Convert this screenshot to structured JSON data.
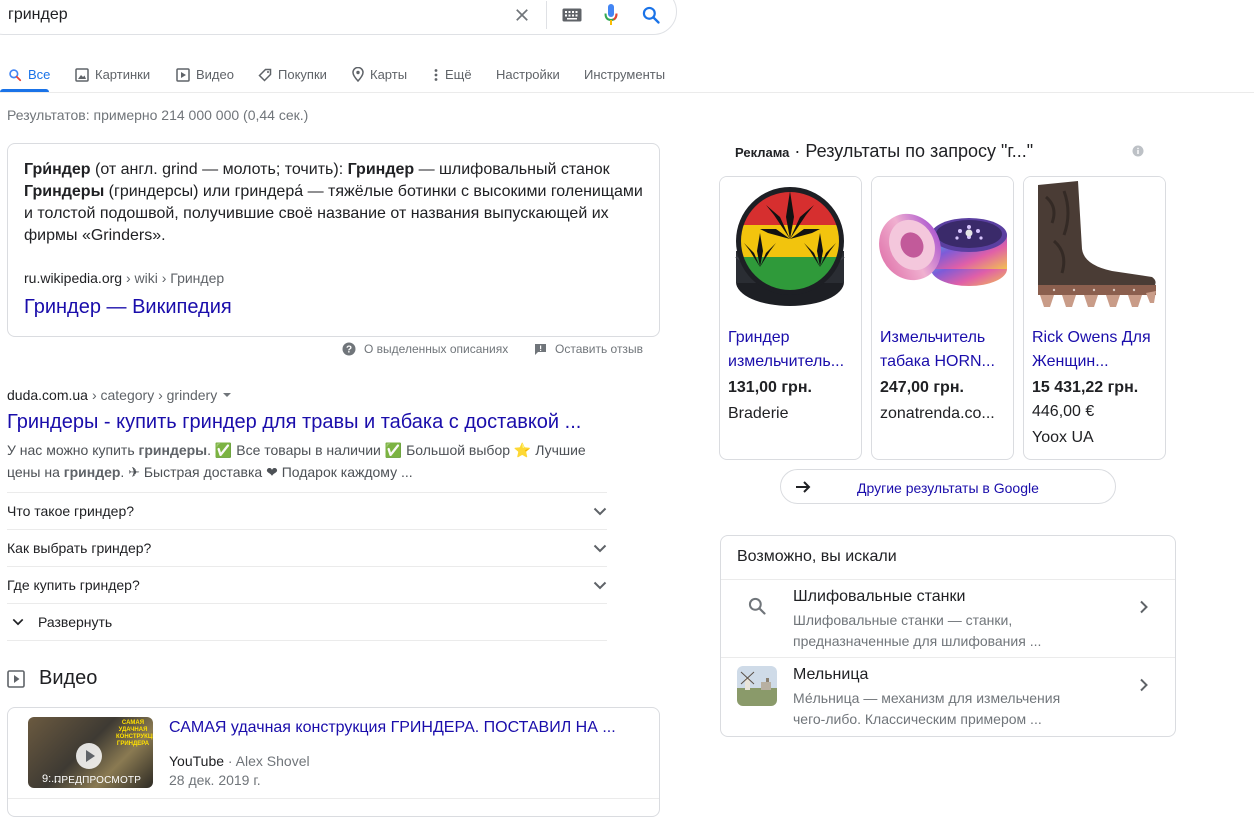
{
  "search": {
    "query": "гриндер"
  },
  "tabs": [
    {
      "label": "Все",
      "icon": "search-icon",
      "active": true
    },
    {
      "label": "Картинки",
      "icon": "image-icon"
    },
    {
      "label": "Видео",
      "icon": "play-icon"
    },
    {
      "label": "Покупки",
      "icon": "tag-icon"
    },
    {
      "label": "Карты",
      "icon": "pin-icon"
    },
    {
      "label": "Ещё",
      "icon": "more-vert-icon"
    },
    {
      "label": "Настройки"
    },
    {
      "label": "Инструменты"
    }
  ],
  "result_stats": "Результатов: примерно 214 000 000 (0,44 сек.)",
  "wiki": {
    "term1": "Гри́ндер",
    "text1": " (от англ. grind — молоть; точить): ",
    "term2": "Гриндер",
    "text2": " — шлифовальный станок",
    "term3": "Гриндеры",
    "text3": " (гриндерсы) или гриндера́ — тяжёлые ботинки с высокими голенищами и толстой подошвой, получившие своё название от названия выпускающей их фирмы «Grinders».",
    "domain": "ru.wikipedia.org",
    "path": " › wiki › Гриндер",
    "title": "Гриндер — Википедия",
    "about_label": "О выделенных описаниях",
    "feedback_label": "Оставить отзыв"
  },
  "result1": {
    "domain": "duda.com.ua",
    "path": " › category › grindery",
    "title": "Гриндеры - купить гриндер для травы и табака с доставкой ...",
    "snippet_a": "У нас можно купить ",
    "snippet_b": "гриндеры",
    "snippet_c": ". ✅ Все товары в наличии ✅ Большой выбор ⭐ Лучшие цены на ",
    "snippet_d": "гриндер",
    "snippet_e": ". ✈ Быстрая доставка ❤ Подарок каждому ...",
    "faqs": [
      "Что такое гриндер?",
      "Как выбрать гриндер?",
      "Где купить гриндер?"
    ],
    "expand_label": "Развернуть"
  },
  "video": {
    "heading": "Видео",
    "title": "САМАЯ удачная конструкция ГРИНДЕРА. ПОСТАВИЛ НА ...",
    "source": "YouTube",
    "author": " · Alex Shovel",
    "date": "28 дек. 2019 г.",
    "duration": "9:...",
    "preview_label": "ПРЕДПРОСМОТР",
    "thumb_text": "САМАЯ УДАЧНАЯ КОНСТРУКЦИЯ ГРИНДЕРА"
  },
  "ads": {
    "label": "Реклама",
    "heading": " · Результаты по запросу \"г...\"",
    "items": [
      {
        "title1": "Гриндер",
        "title2": "измельчитель...",
        "price": "131,00 грн.",
        "store": "Braderie"
      },
      {
        "title1": "Измельчитель",
        "title2": "табака HORN...",
        "price": "247,00 грн.",
        "store": "zonatrenda.co..."
      },
      {
        "title1": "Rick Owens Для",
        "title2": "Женщин...",
        "price": "15 431,22 грн.",
        "old_price": "446,00 €",
        "store": "Yoox UA"
      }
    ],
    "more_label": "Другие результаты в Google"
  },
  "pas": {
    "title": "Возможно, вы искали",
    "items": [
      {
        "name": "Шлифовальные станки",
        "desc": "Шлифовальные станки — станки, предназначенные для шлифования ..."
      },
      {
        "name": "Мельница",
        "desc": "Ме́льница — механизм для измельчения чего-либо. Классическим примером ..."
      }
    ]
  },
  "colors": {
    "link": "#1a0dab",
    "accent": "#1a73e8",
    "mic_blue": "#4285f4",
    "mic_red": "#ea4335"
  }
}
